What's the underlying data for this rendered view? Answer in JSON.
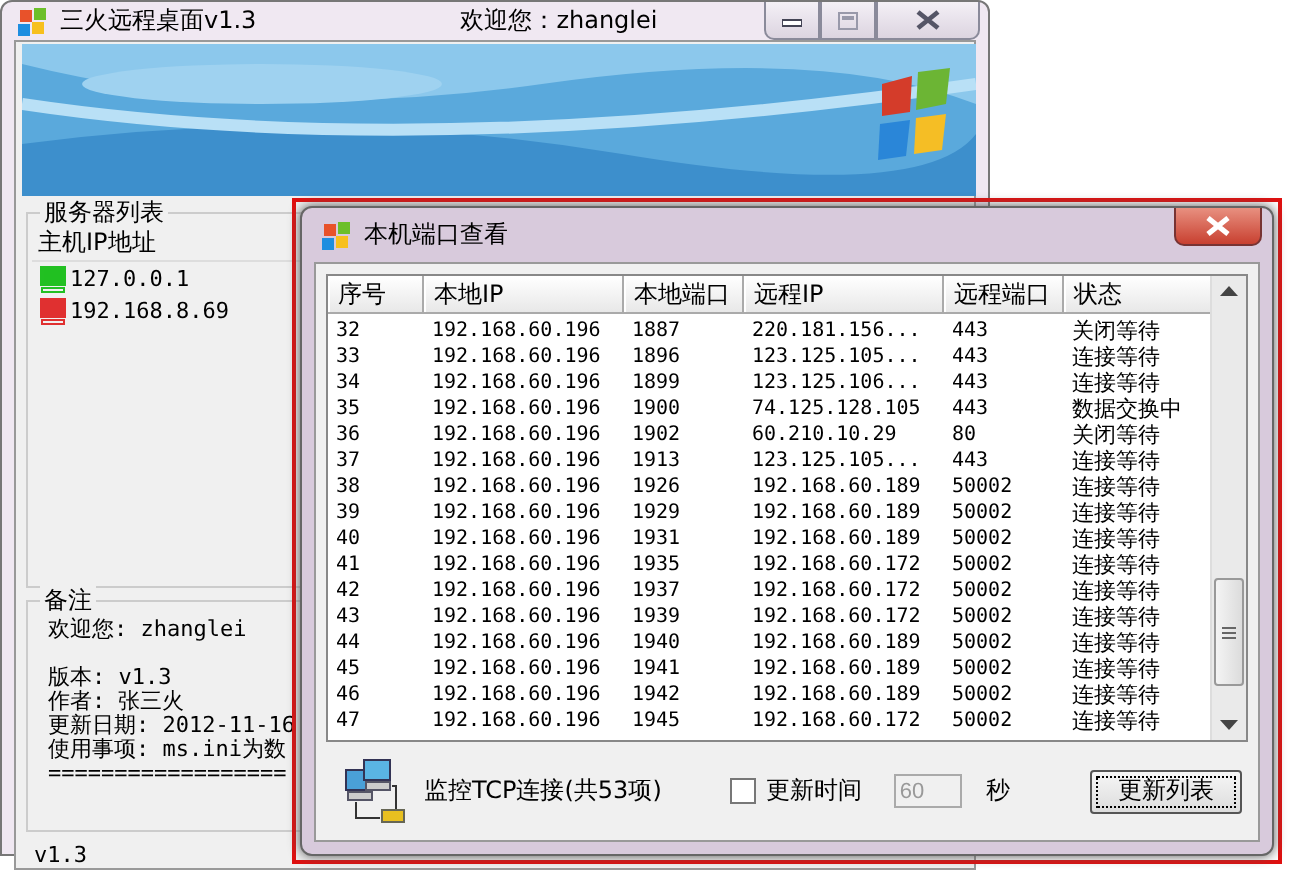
{
  "main_window": {
    "title": "三火远程桌面v1.3",
    "welcome": "欢迎您：zhanglei",
    "server_list": {
      "title": "服务器列表",
      "column": "主机IP地址",
      "items": [
        {
          "ip": "127.0.0.1",
          "color": "#22c022"
        },
        {
          "ip": "192.168.8.69",
          "color": "#e03030"
        }
      ]
    },
    "notes": {
      "title": "备注",
      "lines": [
        "欢迎您: zhanglei",
        "版本: v1.3",
        "作者: 张三火",
        "更新日期: 2012-11-16",
        "使用事项: ms.ini为数",
        "=================="
      ]
    },
    "status_bar": "v1.3"
  },
  "dialog": {
    "title": "本机端口查看",
    "table": {
      "columns": [
        "序号",
        "本地IP",
        "本地端口",
        "远程IP",
        "远程端口",
        "状态"
      ],
      "rows": [
        [
          "32",
          "192.168.60.196",
          "1887",
          "220.181.156...",
          "443",
          "关闭等待"
        ],
        [
          "33",
          "192.168.60.196",
          "1896",
          "123.125.105...",
          "443",
          "连接等待"
        ],
        [
          "34",
          "192.168.60.196",
          "1899",
          "123.125.106...",
          "443",
          "连接等待"
        ],
        [
          "35",
          "192.168.60.196",
          "1900",
          "74.125.128.105",
          "443",
          "数据交换中"
        ],
        [
          "36",
          "192.168.60.196",
          "1902",
          "60.210.10.29",
          "80",
          "关闭等待"
        ],
        [
          "37",
          "192.168.60.196",
          "1913",
          "123.125.105...",
          "443",
          "连接等待"
        ],
        [
          "38",
          "192.168.60.196",
          "1926",
          "192.168.60.189",
          "50002",
          "连接等待"
        ],
        [
          "39",
          "192.168.60.196",
          "1929",
          "192.168.60.189",
          "50002",
          "连接等待"
        ],
        [
          "40",
          "192.168.60.196",
          "1931",
          "192.168.60.189",
          "50002",
          "连接等待"
        ],
        [
          "41",
          "192.168.60.196",
          "1935",
          "192.168.60.172",
          "50002",
          "连接等待"
        ],
        [
          "42",
          "192.168.60.196",
          "1937",
          "192.168.60.172",
          "50002",
          "连接等待"
        ],
        [
          "43",
          "192.168.60.196",
          "1939",
          "192.168.60.172",
          "50002",
          "连接等待"
        ],
        [
          "44",
          "192.168.60.196",
          "1940",
          "192.168.60.189",
          "50002",
          "连接等待"
        ],
        [
          "45",
          "192.168.60.196",
          "1941",
          "192.168.60.189",
          "50002",
          "连接等待"
        ],
        [
          "46",
          "192.168.60.196",
          "1942",
          "192.168.60.189",
          "50002",
          "连接等待"
        ],
        [
          "47",
          "192.168.60.196",
          "1945",
          "192.168.60.172",
          "50002",
          "连接等待"
        ]
      ]
    },
    "monitor_label": "监控TCP连接(共53项)",
    "auto_refresh": {
      "label": "更新时间",
      "checked": false
    },
    "interval": {
      "value": "60",
      "disabled": true
    },
    "unit": "秒",
    "refresh_button": {
      "label": "更新列表",
      "focused": true
    }
  }
}
